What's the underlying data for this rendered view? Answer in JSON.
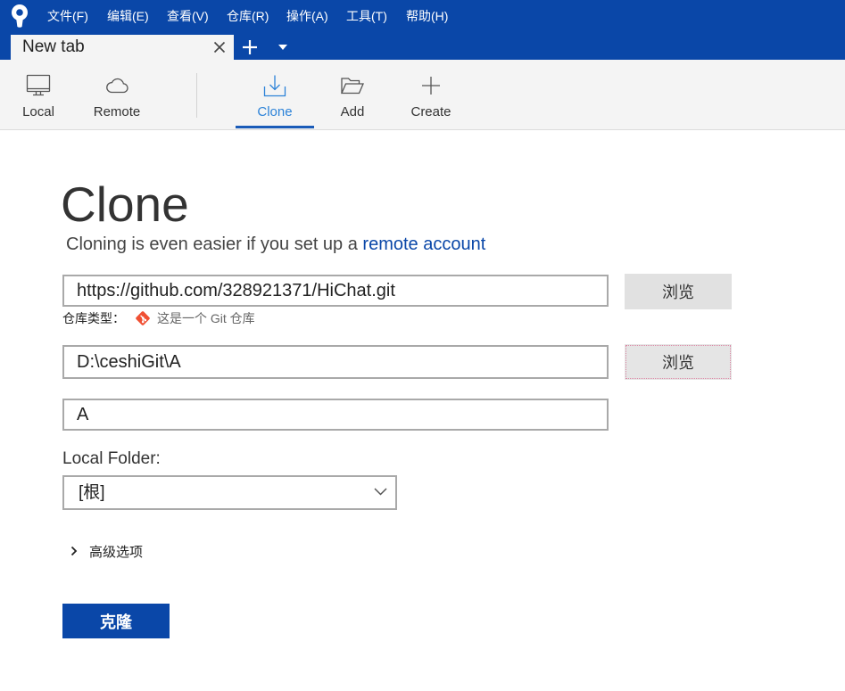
{
  "window": {
    "logo_icon": "sourcetree-logo-icon",
    "menu": [
      {
        "label": "文件(F)"
      },
      {
        "label": "编辑(E)"
      },
      {
        "label": "查看(V)"
      },
      {
        "label": "仓库(R)"
      },
      {
        "label": "操作(A)"
      },
      {
        "label": "工具(T)"
      },
      {
        "label": "帮助(H)"
      }
    ]
  },
  "tabs": {
    "items": [
      {
        "label": "New tab",
        "active": true,
        "close_icon": "close-icon"
      }
    ],
    "new_tab_icon": "plus-icon",
    "tab_list_icon": "caret-down-icon"
  },
  "toolbar": {
    "items": [
      {
        "label": "Local",
        "icon": "monitor-icon",
        "active": false
      },
      {
        "label": "Remote",
        "icon": "cloud-icon",
        "active": false
      },
      {
        "label": "Clone",
        "icon": "download-icon",
        "active": true
      },
      {
        "label": "Add",
        "icon": "folder-open-icon",
        "active": false
      },
      {
        "label": "Create",
        "icon": "plus-icon",
        "active": false
      }
    ]
  },
  "clone_form": {
    "title": "Clone",
    "subtitle": "Cloning is even easier if you set up a",
    "subtitle_link": "remote account",
    "source_url": "https://github.com/328921371/HiChat.git",
    "source_browse_label": "浏览",
    "repo_type_label": "仓库类型：",
    "repo_type_icon": "git-icon",
    "repo_type_value": "这是一个 Git 仓库",
    "destination_path": "D:\\ceshiGit\\A",
    "destination_browse_label": "浏览",
    "name": "A",
    "local_folder_label": "Local Folder:",
    "local_folder_value": "[根]",
    "local_folder_icon": "chevron-down-icon",
    "advanced_options_label": "高级选项",
    "advanced_options_expanded": false,
    "advanced_options_icon": "chevron-right-icon",
    "submit_label": "克隆"
  },
  "colors": {
    "brand": "#0a47a8",
    "active_accent": "#2d83d8",
    "active_underline": "#1a5bb8",
    "link": "#0a47a8",
    "repo_type_icon": "#f05033"
  }
}
